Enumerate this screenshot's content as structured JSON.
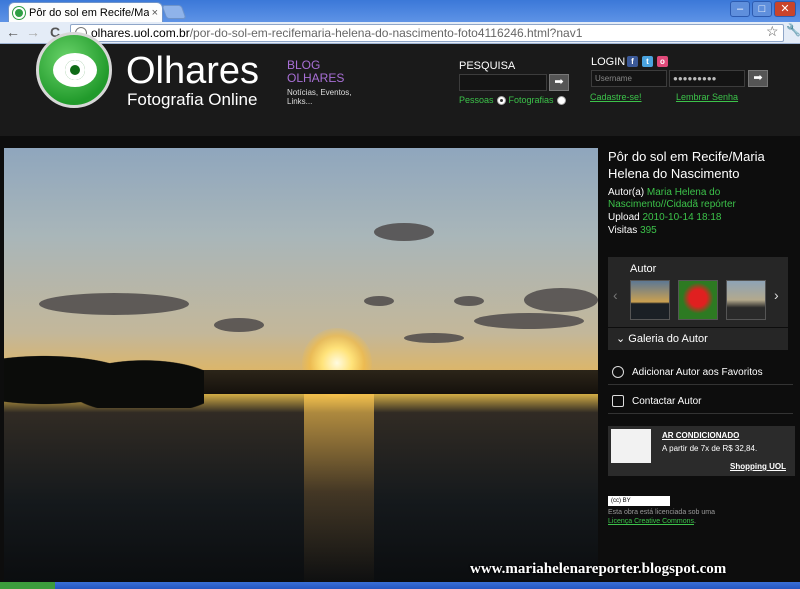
{
  "browser": {
    "tab_title": "Pôr do sol em Recife/Maria Hel",
    "tab_close": "×",
    "url_host": "olhares.uol.com.br",
    "url_path": "/por-do-sol-em-recifemaria-helena-do-nascimento-foto4116246.html?nav1",
    "back_glyph": "←",
    "forward_glyph": "→",
    "reload_glyph": "C",
    "star_glyph": "☆",
    "wrench_glyph": "🔧",
    "min_glyph": "–",
    "max_glyph": "□",
    "close_glyph": "✕"
  },
  "header": {
    "brand": "Olhares",
    "brand_sub": "Fotografia Online",
    "blog_line1": "BLOG",
    "blog_line2": "OLHARES",
    "blog_sub": "Notícias, Eventos, Links...",
    "search_label": "PESQUISA",
    "search_go": "➡",
    "radio_pessoas": "Pessoas",
    "radio_fotografias": "Fotografias",
    "login_label": "LOGIN",
    "username_placeholder": "Username",
    "password_mask": "●●●●●●●●●",
    "login_go": "➡",
    "signup_link": "Cadastre-se!",
    "forgot_link": "Lembrar Senha",
    "social_fb": "f",
    "social_tw": "t",
    "social_other": "o"
  },
  "photo": {
    "title": "Pôr do sol em Recife/Maria Helena do Nascimento",
    "author_label": "Autor(a)",
    "author_name": "Maria Helena do Nascimento//Cidadã repórter",
    "upload_label": "Upload",
    "upload_date": "2010-10-14 18:18",
    "visits_label": "Visitas",
    "visits_count": "395"
  },
  "sidebar": {
    "autor_label": "Autor",
    "prev_glyph": "‹",
    "next_glyph": "›",
    "galeria_label": "Galeria do Autor",
    "galeria_chevron": "⌄",
    "add_fav_label": "Adicionar Autor aos Favoritos",
    "contact_label": "Contactar Autor"
  },
  "ad": {
    "title": "AR CONDICIONADO",
    "price": "A partir de 7x de R$ 32,84.",
    "shop": "Shopping UOL"
  },
  "license": {
    "badge": "(cc) BY",
    "text": "Esta obra está licenciada sob uma",
    "link": "Licença Creative Commons",
    "period": "."
  },
  "watermark": "www.mariahelenareporter.blogspot.com"
}
